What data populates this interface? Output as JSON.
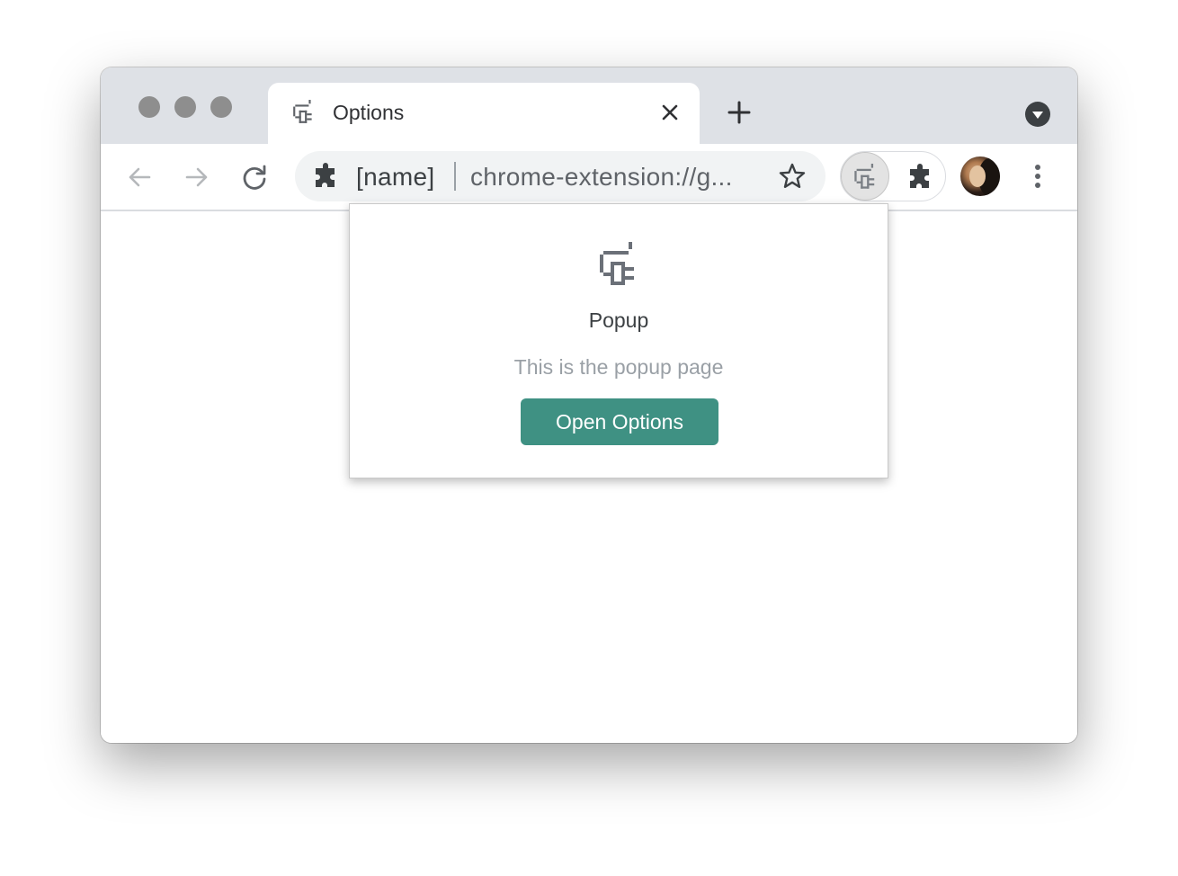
{
  "tab": {
    "title": "Options",
    "icon": "extension-logo-icon",
    "close_icon": "close-icon"
  },
  "tabstrip": {
    "new_tab_icon": "plus-icon",
    "tab_search_icon": "chevron-down-circle-icon"
  },
  "toolbar": {
    "back_icon": "arrow-left-icon",
    "forward_icon": "arrow-right-icon",
    "reload_icon": "reload-icon",
    "omnibox": {
      "site_icon": "puzzle-icon",
      "name": "[name]",
      "url": "chrome-extension://g..."
    },
    "bookmark_icon": "star-icon",
    "active_extension_icon": "extension-logo-icon",
    "extensions_icon": "puzzle-icon",
    "menu_icon": "kebab-menu-icon"
  },
  "popup": {
    "logo_icon": "extension-logo-icon",
    "title": "Popup",
    "description": "This is the popup page",
    "button_label": "Open Options"
  },
  "colors": {
    "tabstrip_bg": "#dee1e6",
    "omnibox_bg": "#f1f3f4",
    "accent_button": "#3f9183",
    "icon_gray": "#5f6368"
  }
}
